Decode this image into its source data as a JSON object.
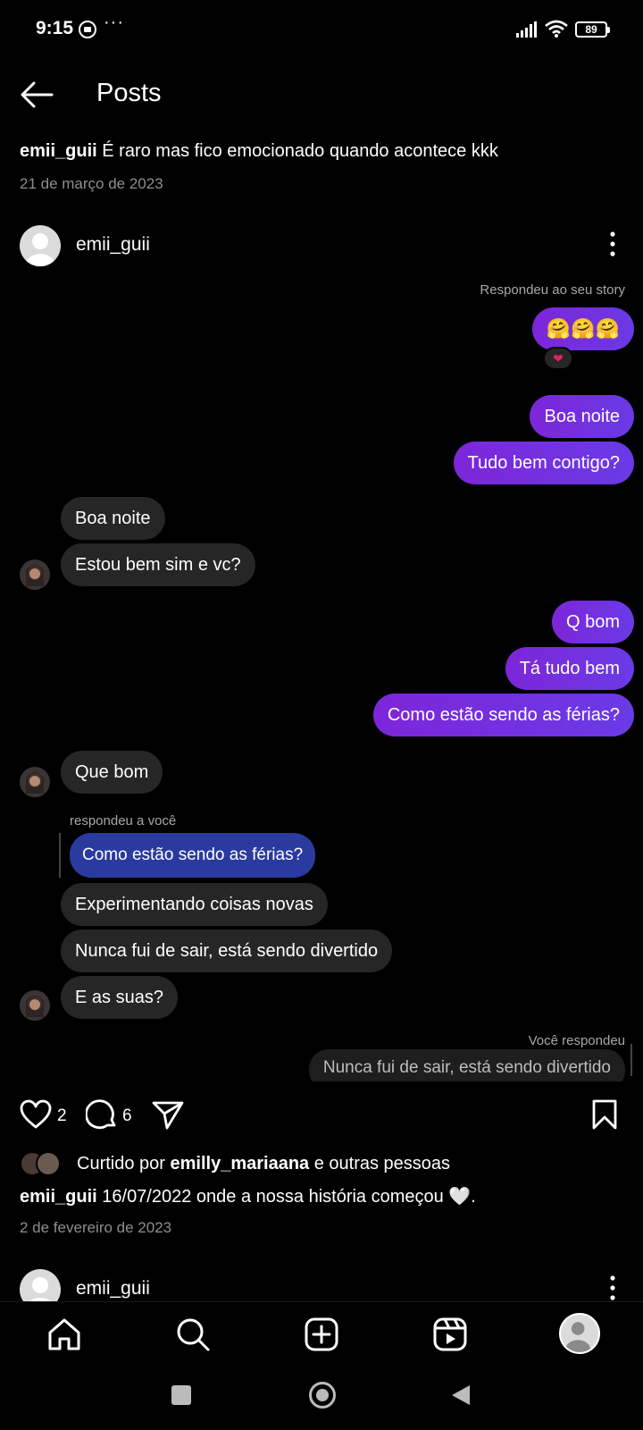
{
  "status_bar": {
    "time": "9:15",
    "more": "···",
    "battery": "89"
  },
  "header": {
    "title": "Posts"
  },
  "prev_post": {
    "username": "emii_guii",
    "caption": " É raro mas fico emocionado quando acontece kkk",
    "date": "21 de março de 2023"
  },
  "post": {
    "username": "emii_guii",
    "chat": {
      "story_reply_label": "Respondeu ao seu story",
      "story_emoji": "🤗🤗🤗",
      "heart_reaction": "❤",
      "messages_out_1": [
        "Boa noite",
        "Tudo bem contigo?"
      ],
      "messages_in_1": [
        "Boa noite",
        "Estou bem sim e vc?"
      ],
      "messages_out_2": [
        "Q bom",
        "Tá tudo bem",
        "Como estão sendo as férias?"
      ],
      "messages_in_2": [
        "Que bom"
      ],
      "reply_label": "respondeu a você",
      "reply_quote": "Como estão sendo as férias?",
      "messages_in_3": [
        "Experimentando coisas novas",
        "Nunca fui de sair, está sendo divertido",
        "E as suas?"
      ],
      "you_replied_label": "Você respondeu",
      "you_replied_quote": "Nunca fui de sair, está sendo divertido"
    },
    "likes_count": "2",
    "comments_count": "6",
    "liked_by_prefix": "Curtido por ",
    "liked_by_user": "emilly_mariaana",
    "liked_by_suffix": " e outras pessoas",
    "caption_user": "emii_guii",
    "caption_text": " 16/07/2022 onde a nossa história começou 🤍.",
    "date": "2 de fevereiro de 2023"
  },
  "next_post": {
    "username": "emii_guii"
  },
  "icons": {
    "back": "back-arrow-icon",
    "heart": "heart-icon",
    "comment": "comment-icon",
    "share": "send-icon",
    "bookmark": "bookmark-icon",
    "home": "home-icon",
    "search": "search-icon",
    "create": "plus-square-icon",
    "reels": "reels-icon"
  },
  "colors": {
    "outgoing_bubble": "#7a2ee0",
    "incoming_bubble": "#262626",
    "reply_quote": "#2a3a9e",
    "secondary_text": "#8e8e8e"
  }
}
